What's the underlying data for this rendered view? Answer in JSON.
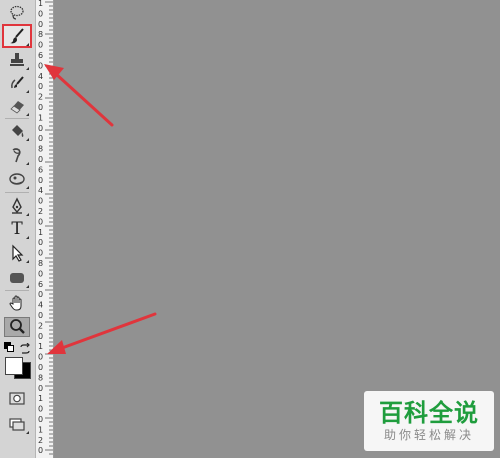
{
  "toolbox": {
    "tools": [
      {
        "name": "lasso-tool",
        "icon": "lasso-icon"
      },
      {
        "name": "brush-tool",
        "icon": "brush-icon",
        "selected": true
      },
      {
        "name": "clone-stamp-tool",
        "icon": "stamp-icon"
      },
      {
        "name": "history-brush-tool",
        "icon": "history-brush-icon"
      },
      {
        "name": "eraser-tool",
        "icon": "eraser-icon"
      },
      {
        "name": "paint-bucket-tool",
        "icon": "paint-bucket-icon"
      },
      {
        "name": "burn-tool",
        "icon": "burn-icon"
      },
      {
        "name": "sponge-tool",
        "icon": "sponge-icon"
      },
      {
        "name": "pen-tool",
        "icon": "pen-icon"
      },
      {
        "name": "type-tool",
        "icon": "type-icon",
        "label": "T"
      },
      {
        "name": "path-selection-tool",
        "icon": "arrow-icon"
      },
      {
        "name": "shape-tool",
        "icon": "rounded-rect-icon"
      },
      {
        "name": "hand-tool",
        "icon": "hand-icon"
      },
      {
        "name": "zoom-tool",
        "icon": "magnifier-icon"
      }
    ],
    "foreground_color": "#ffffff",
    "background_color": "#000000"
  },
  "ruler": {
    "labels": [
      "1",
      "0",
      "0",
      "8",
      "0",
      "6",
      "0",
      "4",
      "0",
      "2",
      "0",
      "1",
      "0",
      "0",
      "8",
      "0",
      "6",
      "0",
      "4",
      "0",
      "2",
      "0",
      "1",
      "0",
      "0",
      "8",
      "0",
      "6",
      "0",
      "4",
      "0",
      "2",
      "0",
      "1",
      "0",
      "0",
      "8",
      "0",
      "1",
      "0",
      "0",
      "1",
      "2",
      "0"
    ]
  },
  "colors": {
    "canvas": "#919191",
    "highlight": "#e0353c",
    "watermark_green": "#1f9d3d"
  },
  "watermark": {
    "title": "百科全说",
    "subtitle": "助你轻松解决"
  }
}
